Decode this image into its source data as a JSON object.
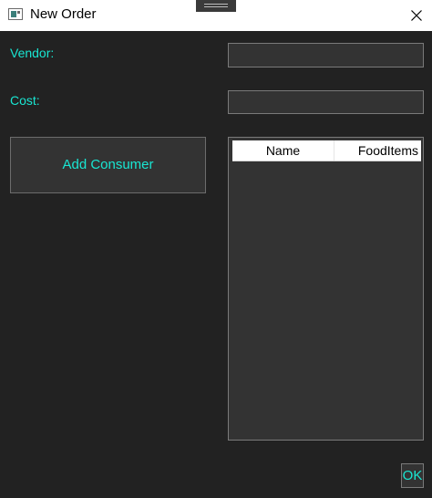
{
  "window": {
    "title": "New Order",
    "icon": "app-window-icon",
    "close_icon": "close-icon",
    "close_glyph": "✕"
  },
  "form": {
    "vendor_label": "Vendor:",
    "vendor_value": "",
    "cost_label": "Cost:",
    "cost_value": "",
    "add_consumer_label": "Add Consumer",
    "ok_label": "OK"
  },
  "consumers_list": {
    "columns": [
      "Name",
      "FoodItems"
    ],
    "rows": []
  },
  "colors": {
    "background": "#222222",
    "control_background": "#333333",
    "accent_text": "#19e6d2",
    "titlebar": "#ffffff",
    "border": "#7a7a7a"
  }
}
